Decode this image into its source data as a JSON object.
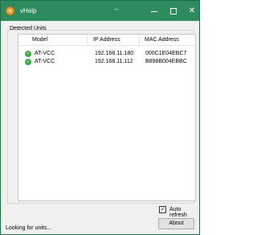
{
  "window": {
    "title": "vHelp",
    "accent_color": "#2e8b5e",
    "controls": {
      "minimize_icon": "minimize-icon",
      "maximize_icon": "maximize-icon",
      "close_icon": "close-icon"
    }
  },
  "detected_units": {
    "group_label": "Detected Units",
    "columns": [
      "Model",
      "IP Address",
      "MAC Address"
    ],
    "rows": [
      {
        "status_icon": "check-circle-icon",
        "model": "AT-VCC",
        "ip": "192.168.11.180",
        "mac": "000C1E04EBC7"
      },
      {
        "status_icon": "check-circle-icon",
        "model": "AT-VCC",
        "ip": "192.168.11.112",
        "mac": "B898B004EBBC"
      }
    ]
  },
  "options": {
    "auto_refresh_label": "Auto refresh",
    "auto_refresh_checked": true
  },
  "about_button": "About",
  "status_bar": "Looking for units..."
}
